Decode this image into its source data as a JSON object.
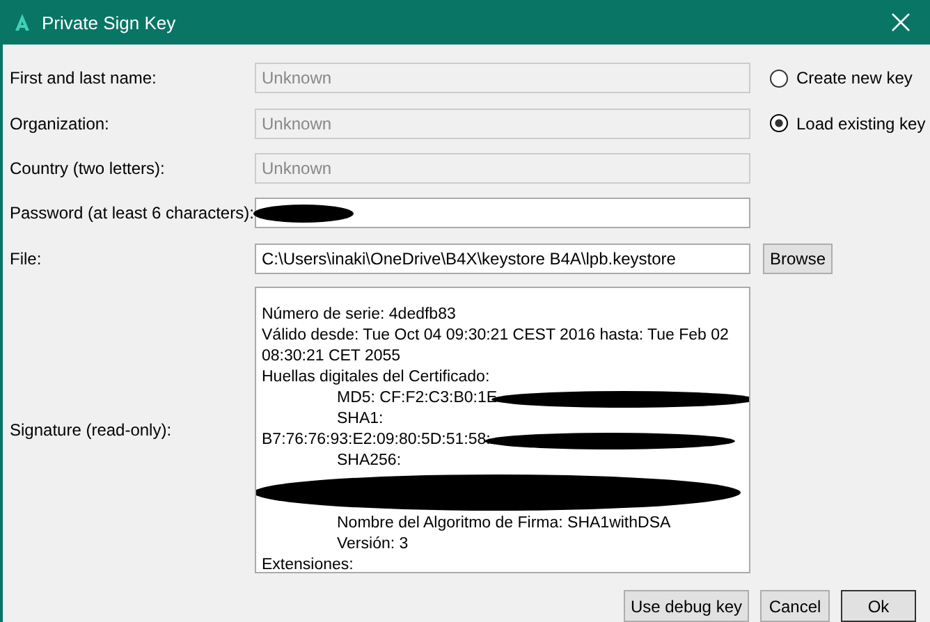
{
  "window": {
    "title": "Private Sign Key"
  },
  "fields": [
    {
      "label": "First and last name:",
      "value": "Unknown",
      "disabled": true
    },
    {
      "label": "Organization:",
      "value": "Unknown",
      "disabled": true
    },
    {
      "label": "Country (two letters):",
      "value": "Unknown",
      "disabled": true
    }
  ],
  "options": [
    {
      "label": "Create new key",
      "selected": false
    },
    {
      "label": "Load existing key",
      "selected": true
    }
  ],
  "password": {
    "label": "Password (at least 6 characters):",
    "redacted": true
  },
  "file": {
    "label": "File:",
    "value": "C:\\Users\\inaki\\OneDrive\\B4X\\keystore B4A\\lpb.keystore",
    "browse": "Browse"
  },
  "signature": {
    "label": "Signature (read-only):",
    "lines": [
      {
        "kind": "plain",
        "text": "Número de serie: 4dedfb83",
        "redacted": false
      },
      {
        "kind": "plain",
        "text": "Válido desde: Tue Oct 04 09:30:21 CEST 2016 hasta: Tue Feb 02 08:30:21 CET 2055",
        "redacted": false
      },
      {
        "kind": "plain",
        "text": "Huellas digitales del Certificado:",
        "redacted": false
      },
      {
        "kind": "indented",
        "text": "MD5: CF:F2:C3:B0:1E",
        "redacted": true
      },
      {
        "kind": "indented",
        "text": "SHA1:",
        "redacted": false
      },
      {
        "kind": "plain",
        "text": "B7:76:76:93:E2:09:80:5D:51:58:",
        "redacted": true
      },
      {
        "kind": "indented",
        "text": "SHA256:",
        "redacted": false
      },
      {
        "kind": "hidden"
      },
      {
        "kind": "indented",
        "text": "Nombre del Algoritmo de Firma: SHA1withDSA",
        "redacted": false
      },
      {
        "kind": "indented",
        "text": "Versión: 3",
        "redacted": false
      },
      {
        "kind": "plain",
        "text": "Extensiones:",
        "redacted": false
      }
    ]
  },
  "buttons": [
    {
      "label": "Use debug key",
      "default": false
    },
    {
      "label": "Cancel",
      "default": false
    },
    {
      "label": "Ok",
      "default": true
    }
  ]
}
